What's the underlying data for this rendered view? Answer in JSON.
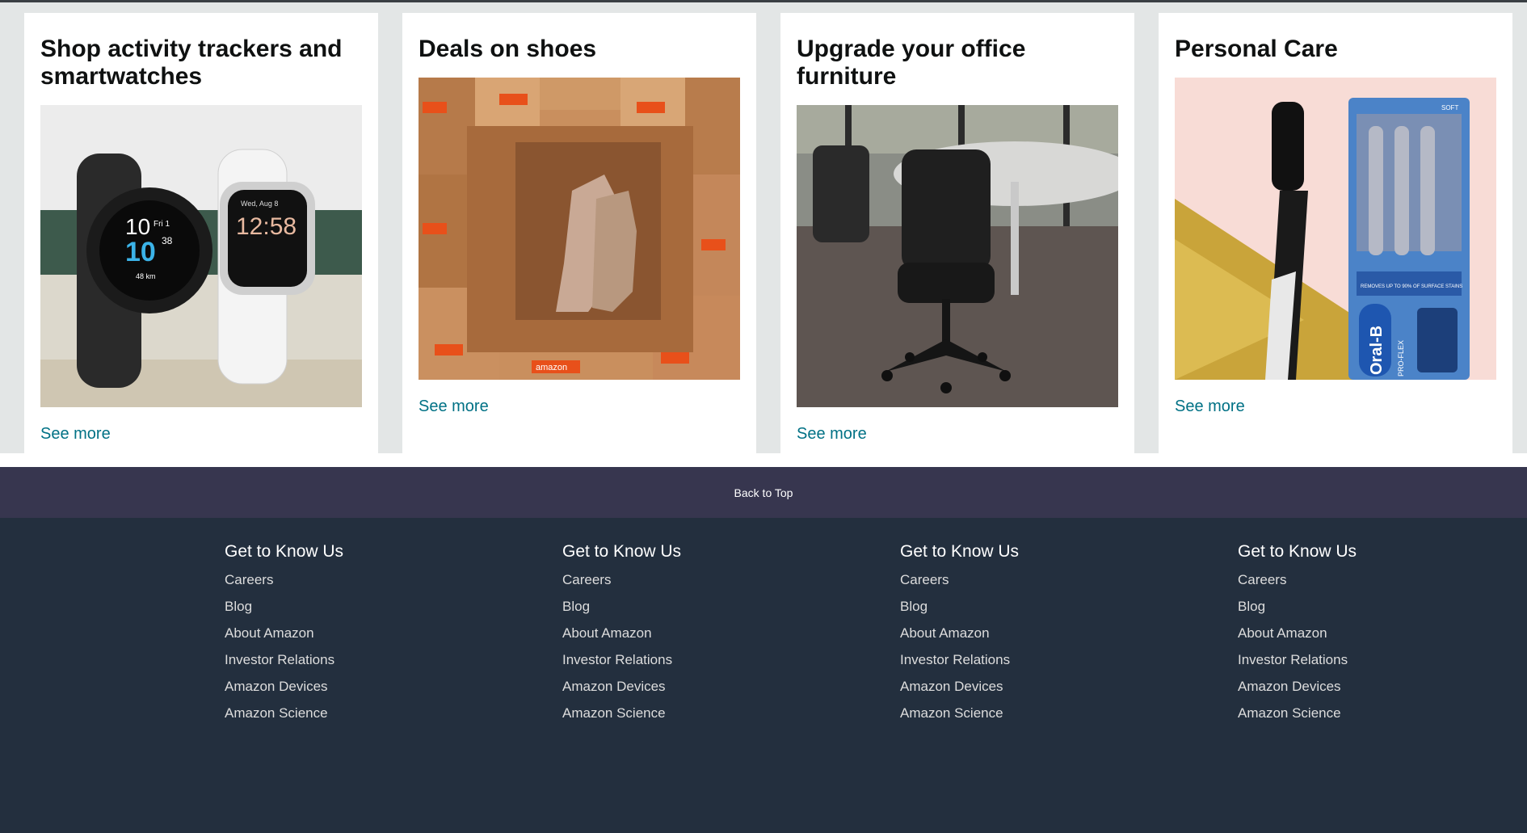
{
  "cards": [
    {
      "title": "Shop activity trackers and smartwatches",
      "link": "See more",
      "image": "smartwatches-photo",
      "watch_time_1": "10",
      "watch_time_2": "10",
      "watch_date": "Fri 1",
      "watch_sec": "38",
      "watch_km": "48 km",
      "watch2_date": "Wed, Aug 8",
      "watch2_time": "12:58"
    },
    {
      "title": "Deals on shoes",
      "link": "See more",
      "image": "shoes-in-boxes-photo",
      "box_brand": "amazon"
    },
    {
      "title": "Upgrade your office furniture",
      "link": "See more",
      "image": "office-chair-photo"
    },
    {
      "title": "Personal Care",
      "link": "See more",
      "image": "toothbrush-photo",
      "pack_label": "SOFT",
      "pack_claim": "REMOVES UP TO 90% OF SURFACE STAINS",
      "pack_brand": "Oral-B",
      "pack_line": "PRO-FLEX"
    }
  ],
  "back_to_top": "Back to Top",
  "footer": {
    "columns": [
      {
        "heading": "Get to Know Us",
        "links": [
          "Careers",
          "Blog",
          "About Amazon",
          "Investor Relations",
          "Amazon Devices",
          "Amazon Science"
        ]
      },
      {
        "heading": "Get to Know Us",
        "links": [
          "Careers",
          "Blog",
          "About Amazon",
          "Investor Relations",
          "Amazon Devices",
          "Amazon Science"
        ]
      },
      {
        "heading": "Get to Know Us",
        "links": [
          "Careers",
          "Blog",
          "About Amazon",
          "Investor Relations",
          "Amazon Devices",
          "Amazon Science"
        ]
      },
      {
        "heading": "Get to Know Us",
        "links": [
          "Careers",
          "Blog",
          "About Amazon",
          "Investor Relations",
          "Amazon Devices",
          "Amazon Science"
        ]
      }
    ]
  },
  "colors": {
    "link": "#007185",
    "back_to_top_bg": "#37364f",
    "footer_bg": "#232f3e",
    "page_bg": "#e3e6e6"
  }
}
